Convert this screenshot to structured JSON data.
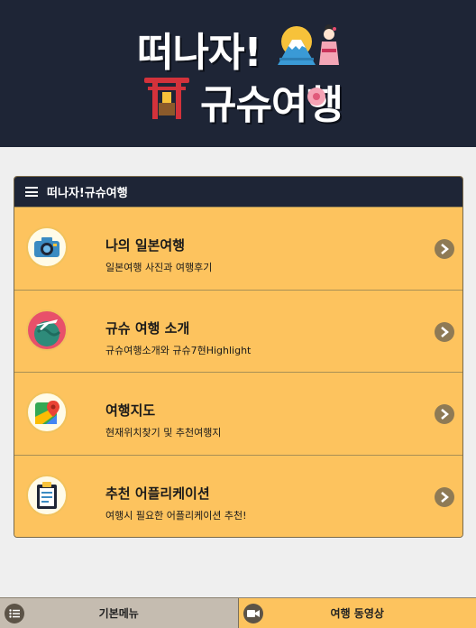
{
  "header": {
    "title_line1": "떠나자!",
    "title_line2": "규슈여행"
  },
  "menu": {
    "title": "떠나자!규슈여행",
    "items": [
      {
        "title": "나의 일본여행",
        "subtitle": "일본여행 사진과 여행후기",
        "icon": "camera-icon"
      },
      {
        "title": "규슈 여행 소개",
        "subtitle": "규슈여행소개와 규슈7현Highlight",
        "icon": "globe-airplane-icon"
      },
      {
        "title": "여행지도",
        "subtitle": "현재위치찾기 및 추천여행지",
        "icon": "map-pin-icon"
      },
      {
        "title": "추천 어플리케이션",
        "subtitle": "여행시 필요한 어플리케이션 추천!",
        "icon": "clipboard-icon"
      }
    ]
  },
  "bottom_nav": {
    "basic_label": "기본메뉴",
    "video_label": "여행 동영상"
  },
  "colors": {
    "header_bg": "#1e2536",
    "menu_bg": "#fdc35e",
    "page_bg": "#efefef"
  }
}
